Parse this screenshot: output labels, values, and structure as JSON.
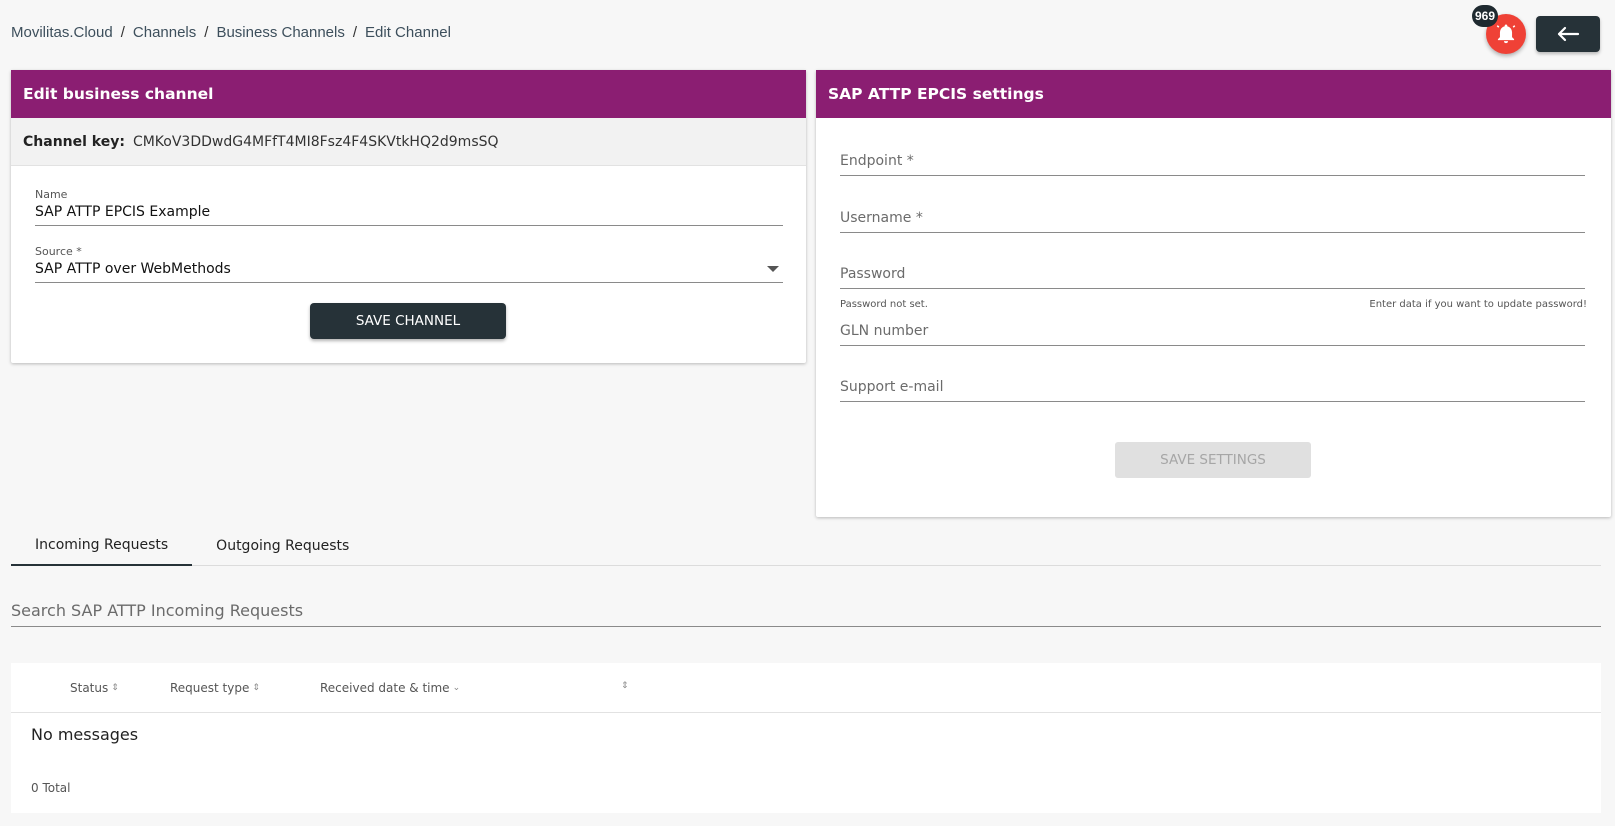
{
  "breadcrumb": {
    "items": [
      "Movilitas.Cloud",
      "Channels",
      "Business Channels",
      "Edit Channel"
    ],
    "separator": "/"
  },
  "header": {
    "notifications_count": "969",
    "bell_icon": "bell-icon",
    "back_icon": "arrow-left-icon"
  },
  "edit_channel": {
    "title": "Edit business channel",
    "channel_key_label": "Channel key:",
    "channel_key_value": "CMKoV3DDwdG4MFfT4MI8Fsz4F4SKVtkHQ2d9msSQ",
    "name_label": "Name",
    "name_value": "SAP ATTP EPCIS Example",
    "source_label": "Source *",
    "source_value": "SAP ATTP over WebMethods",
    "save_label": "SAVE CHANNEL"
  },
  "settings": {
    "title": "SAP ATTP EPCIS settings",
    "endpoint_placeholder": "Endpoint *",
    "username_placeholder": "Username *",
    "password_placeholder": "Password",
    "password_hint_left": "Password not set.",
    "password_hint_right": "Enter data if you want to update password!",
    "gln_placeholder": "GLN number",
    "support_email_placeholder": "Support e-mail",
    "save_label": "SAVE SETTINGS"
  },
  "tabs": {
    "incoming": "Incoming Requests",
    "outgoing": "Outgoing Requests",
    "active": "incoming"
  },
  "search": {
    "placeholder": "Search SAP ATTP Incoming Requests"
  },
  "table": {
    "columns": {
      "status": "Status",
      "request_type": "Request type",
      "received": "Received date & time"
    },
    "empty_text": "No messages",
    "total_text": "0 Total"
  },
  "colors": {
    "header_purple": "#8b1e72",
    "dark": "#263238",
    "bell_red": "#ef4136"
  }
}
